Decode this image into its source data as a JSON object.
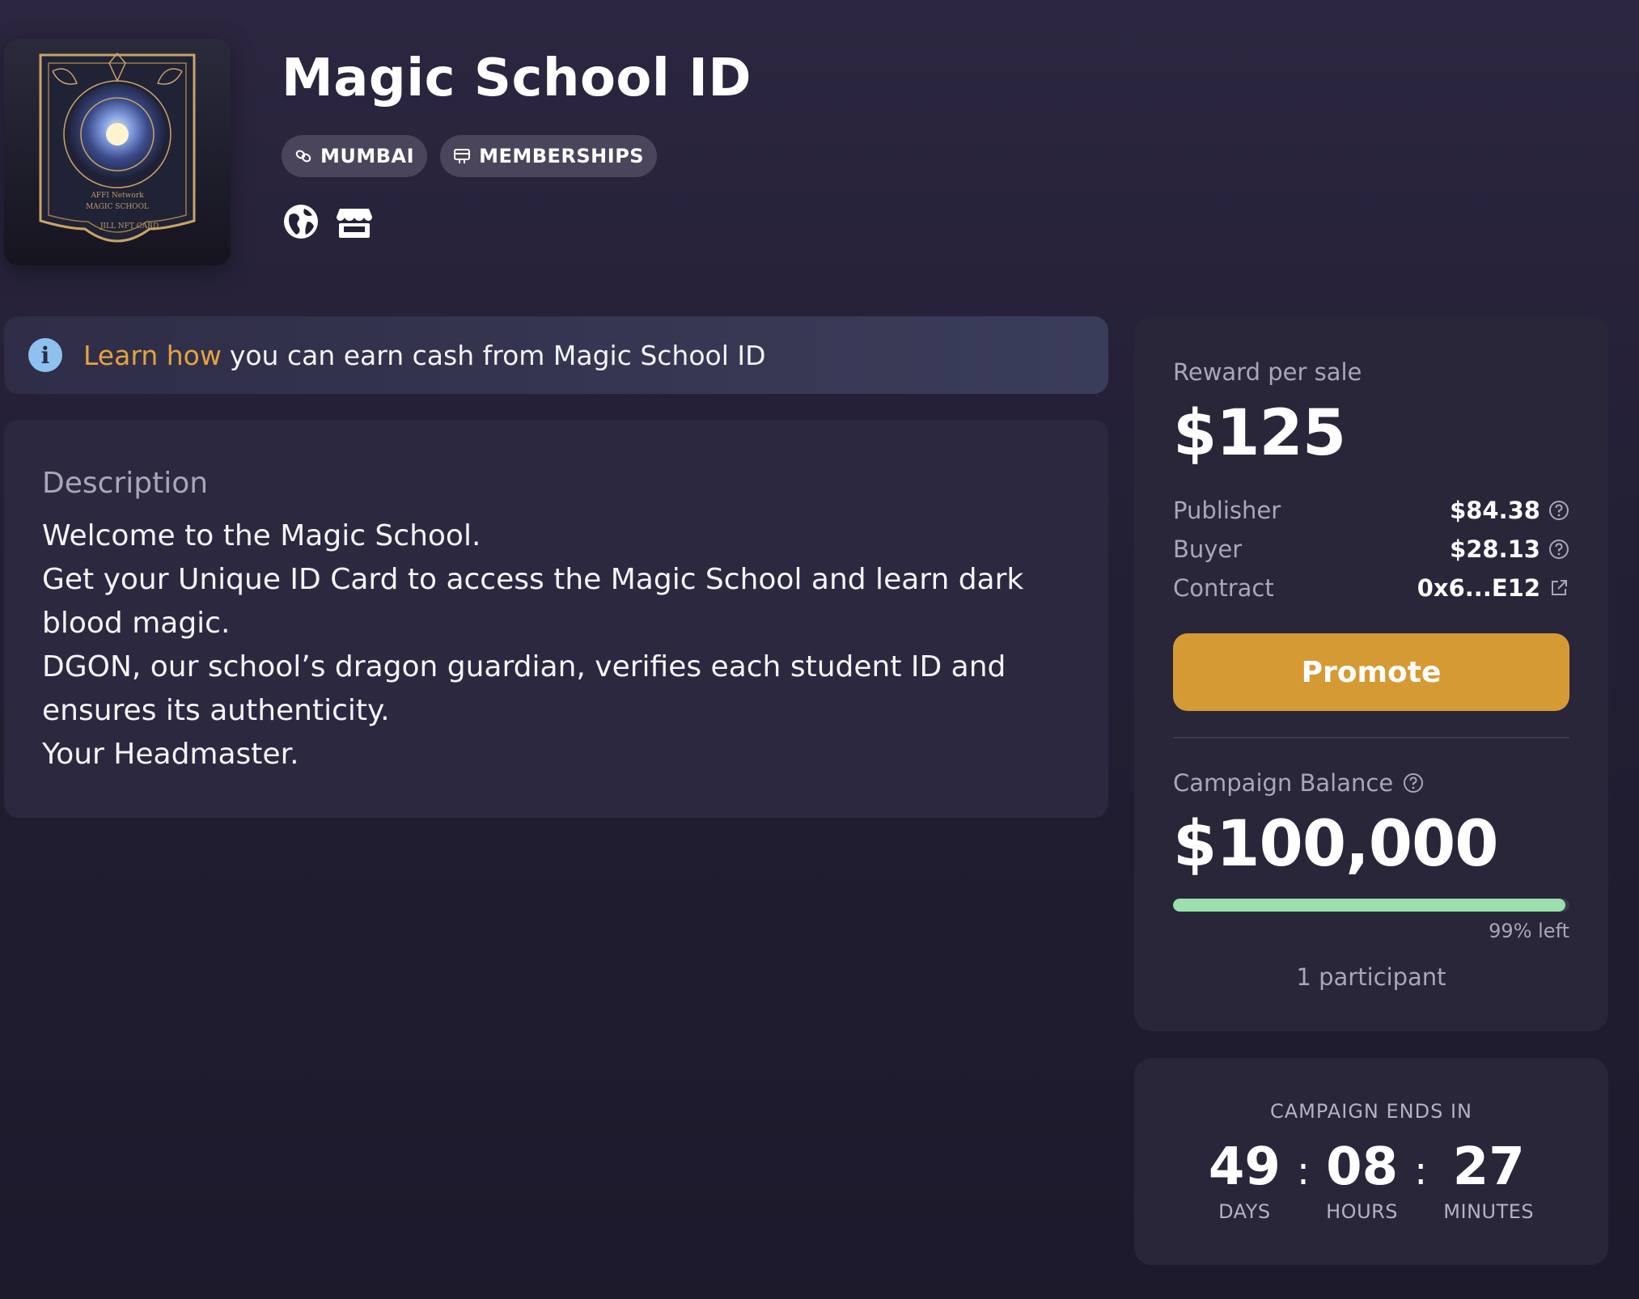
{
  "title": "Magic School ID",
  "cover": {
    "line1": "AFFI Network",
    "line2": "MAGIC SCHOOL",
    "line3": "JILL NFT CARD"
  },
  "tags": [
    {
      "label": "MUMBAI",
      "icon": "link-icon"
    },
    {
      "label": "MEMBERSHIPS",
      "icon": "membership-card-icon"
    }
  ],
  "links": [
    {
      "icon": "globe-icon"
    },
    {
      "icon": "storefront-icon"
    }
  ],
  "info_banner": {
    "link_text": "Learn how",
    "text": "you can earn cash from Magic School ID"
  },
  "description": {
    "label": "Description",
    "lines": [
      "Welcome to the Magic School.",
      "Get your Unique ID Card to access the Magic School and learn dark blood magic.",
      "DGON, our school’s dragon guardian, verifies each student ID and ensures its authenticity.",
      "Your Headmaster."
    ]
  },
  "reward": {
    "label": "Reward per sale",
    "amount": "$125",
    "publisher_label": "Publisher",
    "publisher_value": "$84.38",
    "buyer_label": "Buyer",
    "buyer_value": "$28.13",
    "contract_label": "Contract",
    "contract_value": "0x6...E12",
    "promote_label": "Promote"
  },
  "campaign": {
    "balance_label": "Campaign Balance",
    "balance_amount": "$100,000",
    "progress_fraction": 0.99,
    "progress_text": "99% left",
    "participants_text": "1 participant"
  },
  "timer": {
    "title": "CAMPAIGN ENDS IN",
    "days": "49",
    "days_label": "DAYS",
    "hours": "08",
    "hours_label": "HOURS",
    "minutes": "27",
    "minutes_label": "MINUTES",
    "separator": ":"
  },
  "colors": {
    "accent": "#d69a35",
    "link": "#e3a33d",
    "progress": "#9be0aa",
    "info": "#8fc1f0"
  }
}
